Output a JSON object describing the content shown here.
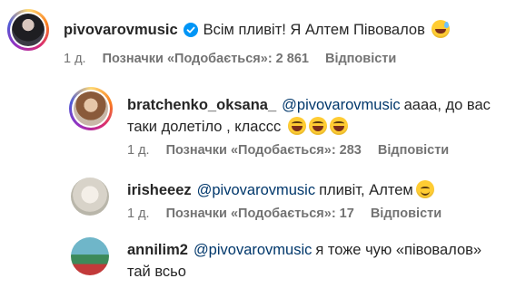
{
  "comments": [
    {
      "username": "pivovarovmusic",
      "verified": true,
      "text": "Всім пливіт! Я Алтем Півовалов",
      "emoji": "grinning-sweat",
      "time": "1 д.",
      "likes": "Позначки «Подобається»: 2 861",
      "reply": "Відповісти"
    },
    {
      "username": "bratchenko_oksana_",
      "mention": "@pivovarovmusic",
      "text": "аааа, до вас таки долетіло , класcс",
      "emoji": "tears-of-joy x3",
      "time": "1 д.",
      "likes": "Позначки «Подобається»: 283",
      "reply": "Відповісти"
    },
    {
      "username": "irisheeez",
      "mention": "@pivovarovmusic",
      "text": "пливіт, Алтем",
      "emoji": "smiling-face",
      "time": "1 д.",
      "likes": "Позначки «Подобається»: 17",
      "reply": "Відповісти"
    },
    {
      "username": "annilim2",
      "mention": "@pivovarovmusic",
      "text": "я тоже чую «півовалов» тай всьо"
    }
  ],
  "colors": {
    "verified": "#0095f6",
    "mention": "#00376b",
    "meta": "#737373"
  }
}
